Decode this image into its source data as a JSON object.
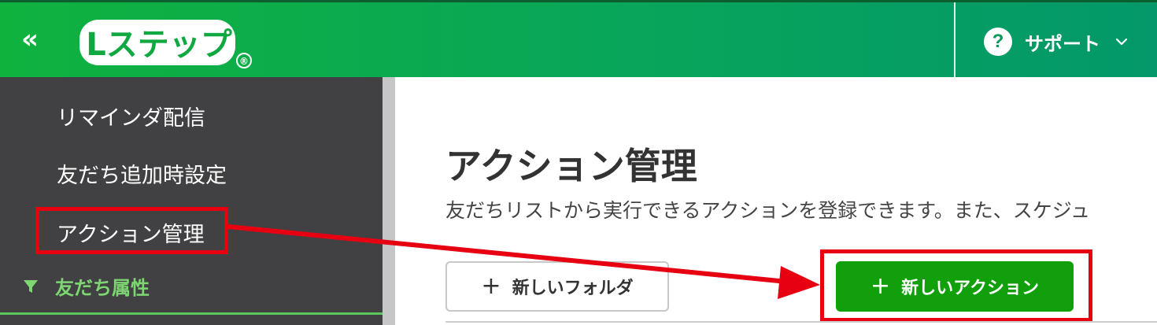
{
  "header": {
    "collapse_symbol": "«",
    "logo_text": "Lステップ",
    "logo_mark": "®",
    "support": {
      "icon_char": "?",
      "label": "サポート"
    }
  },
  "sidebar": {
    "items": [
      {
        "label": "リマインダ配信"
      },
      {
        "label": "友だち追加時設定"
      },
      {
        "label": "アクション管理"
      }
    ],
    "section": {
      "label": "友だち属性"
    }
  },
  "main": {
    "title": "アクション管理",
    "description": "友だちリストから実行できるアクションを登録できます。また、スケジュ",
    "buttons": {
      "new_folder": "新しいフォルダ",
      "new_action": "新しいアクション",
      "plus": "+"
    }
  },
  "colors": {
    "header_green": "#08a55a",
    "sidebar_bg": "#414143",
    "section_green": "#7ed672",
    "primary_button": "#11a00b",
    "annotation_red": "#e60012"
  },
  "icons": {
    "collapse": "double-chevron-left-icon",
    "help": "question-circle-icon",
    "chevron": "chevron-down-icon",
    "filter": "filter-icon",
    "plus": "plus-icon"
  }
}
